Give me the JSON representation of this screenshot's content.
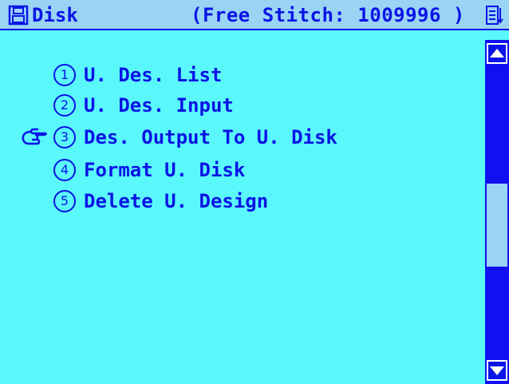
{
  "titlebar": {
    "title": "Disk",
    "free_stitch": "(Free Stitch: 1009996 )",
    "disk_icon": "floppy-disk-icon",
    "corner_icon": "document-list-icon"
  },
  "menu": {
    "selected_index": 2,
    "items": [
      {
        "number": "1",
        "label": "U. Des. List"
      },
      {
        "number": "2",
        "label": "U. Des. Input"
      },
      {
        "number": "3",
        "label": "Des. Output To U. Disk"
      },
      {
        "number": "4",
        "label": "Format U. Disk"
      },
      {
        "number": "5",
        "label": "Delete U. Design"
      }
    ]
  },
  "scrollbar": {
    "up_icon": "triangle-up-icon",
    "down_icon": "triangle-down-icon"
  },
  "colors": {
    "background": "#5AF7FB",
    "text": "#0A14E6",
    "titlebar": "#9AD4F5",
    "scrollbar_track": "#1010F0",
    "scrollbar_thumb": "#9AD4F5"
  }
}
